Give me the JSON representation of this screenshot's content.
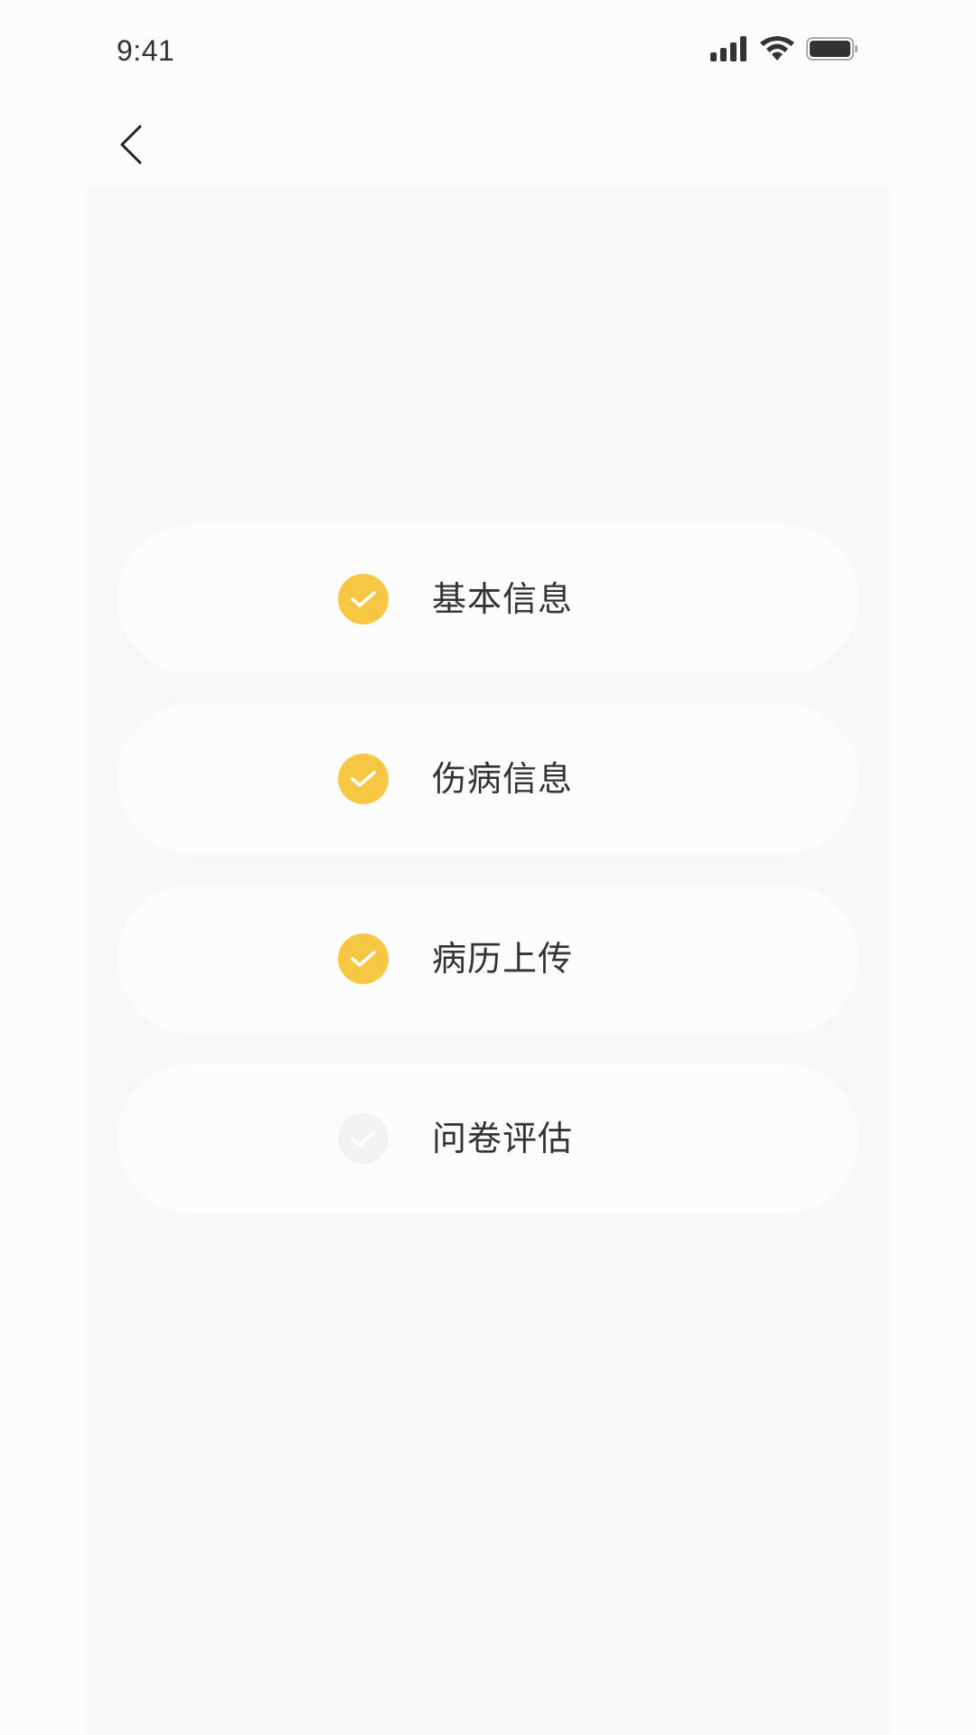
{
  "status_bar": {
    "time": "9:41"
  },
  "nav": {
    "back_icon": "chevron-left-icon"
  },
  "colors": {
    "accent": "#f7c744",
    "pending": "#f2f2f2",
    "text": "#333333",
    "panel": "#f8f8f9",
    "card": "#fcfcfc"
  },
  "steps": [
    {
      "label": "基本信息",
      "status": "done"
    },
    {
      "label": "伤病信息",
      "status": "done"
    },
    {
      "label": "病历上传",
      "status": "done"
    },
    {
      "label": "问卷评估",
      "status": "pending"
    }
  ]
}
